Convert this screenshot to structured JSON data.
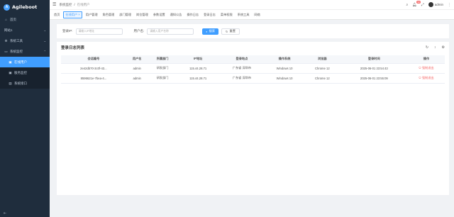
{
  "app": {
    "title": "Agileboot"
  },
  "sidebar": {
    "items": [
      {
        "label": "首页",
        "icon": "home-icon"
      },
      {
        "label": "网站1",
        "icon": "",
        "arrow": "⌄"
      },
      {
        "label": "系统工具",
        "icon": "tool-icon",
        "arrow": "⌄"
      },
      {
        "label": "系统监控",
        "icon": "monitor-icon",
        "arrow": "⌃"
      },
      {
        "label": "在线用户",
        "icon": "user-icon",
        "active": true
      },
      {
        "label": "服务监控",
        "icon": "server-icon"
      },
      {
        "label": "系统接口",
        "icon": "api-icon"
      }
    ]
  },
  "breadcrumb": {
    "parent": "系统监控",
    "sep": "/",
    "current": "在线用户"
  },
  "header": {
    "badge_count": "99",
    "username": "admin"
  },
  "tabs": [
    "首页",
    "在线用户 ×",
    "用户管理",
    "角色管理",
    "部门管理",
    "岗位管理",
    "参数设置",
    "通知公告",
    "操作日志",
    "登录日志",
    "菜单权限",
    "系统工具",
    "网络"
  ],
  "search": {
    "login_ip_label": "登录IP:",
    "login_ip_placeholder": "请输入IP地址",
    "username_label": "用户名:",
    "username_placeholder": "请输入用户名称",
    "search_button": "搜索",
    "reset_button": "重置"
  },
  "table": {
    "title": "登录日志列表",
    "columns": [
      "会话编号",
      "用户名",
      "所属部门",
      "IP地址",
      "登录地点",
      "操作系统",
      "浏览器",
      "登录时间",
      "操作"
    ],
    "rows": [
      [
        "2e42db70-3c0f-43...",
        "admin",
        "研发部门",
        "115.44.28.71",
        "广东省 深圳市",
        "Windows 10",
        "Chrome 12",
        "2025-06-01 23:54:43",
        "强制退出"
      ],
      [
        "8596621e-7bea-4...",
        "admin",
        "研发部门",
        "115.44.28.71",
        "广东省 深圳市",
        "Windows 10",
        "Chrome 12",
        "2025-06-01 23:55:09",
        "强制退出"
      ]
    ]
  },
  "colors": {
    "accent": "#409eff",
    "sidebar_bg": "#1f2d3d",
    "danger": "#f56c6c"
  }
}
